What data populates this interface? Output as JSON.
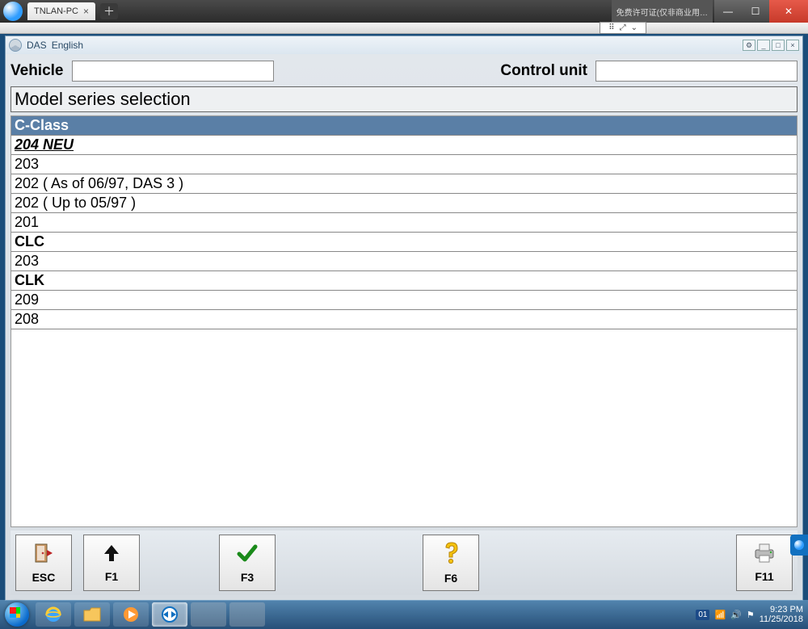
{
  "browser": {
    "tab_title": "TNLAN-PC",
    "badge_text": "免费许可证(仅非商业用…"
  },
  "app_window": {
    "title_prefix": "DAS",
    "title_lang": "English"
  },
  "fields": {
    "vehicle_label": "Vehicle",
    "vehicle_value": "",
    "control_unit_label": "Control unit",
    "control_unit_value": ""
  },
  "section_heading": "Model series selection",
  "list": [
    {
      "text": "C-Class",
      "kind": "header"
    },
    {
      "text": "204 NEU",
      "kind": "selected"
    },
    {
      "text": "203",
      "kind": "item"
    },
    {
      "text": "202 ( As of 06/97, DAS 3 )",
      "kind": "item"
    },
    {
      "text": "202 ( Up to 05/97 )",
      "kind": "item"
    },
    {
      "text": "201",
      "kind": "item"
    },
    {
      "text": "CLC",
      "kind": "subheader"
    },
    {
      "text": "203",
      "kind": "item"
    },
    {
      "text": "CLK",
      "kind": "subheader"
    },
    {
      "text": "209",
      "kind": "item"
    },
    {
      "text": "208",
      "kind": "item"
    }
  ],
  "fkeys": {
    "esc": "ESC",
    "f1": "F1",
    "f3": "F3",
    "f6": "F6",
    "f11": "F11"
  },
  "taskbar": {
    "lang_chip": "01",
    "time": "9:23 PM",
    "date": "11/25/2018"
  }
}
